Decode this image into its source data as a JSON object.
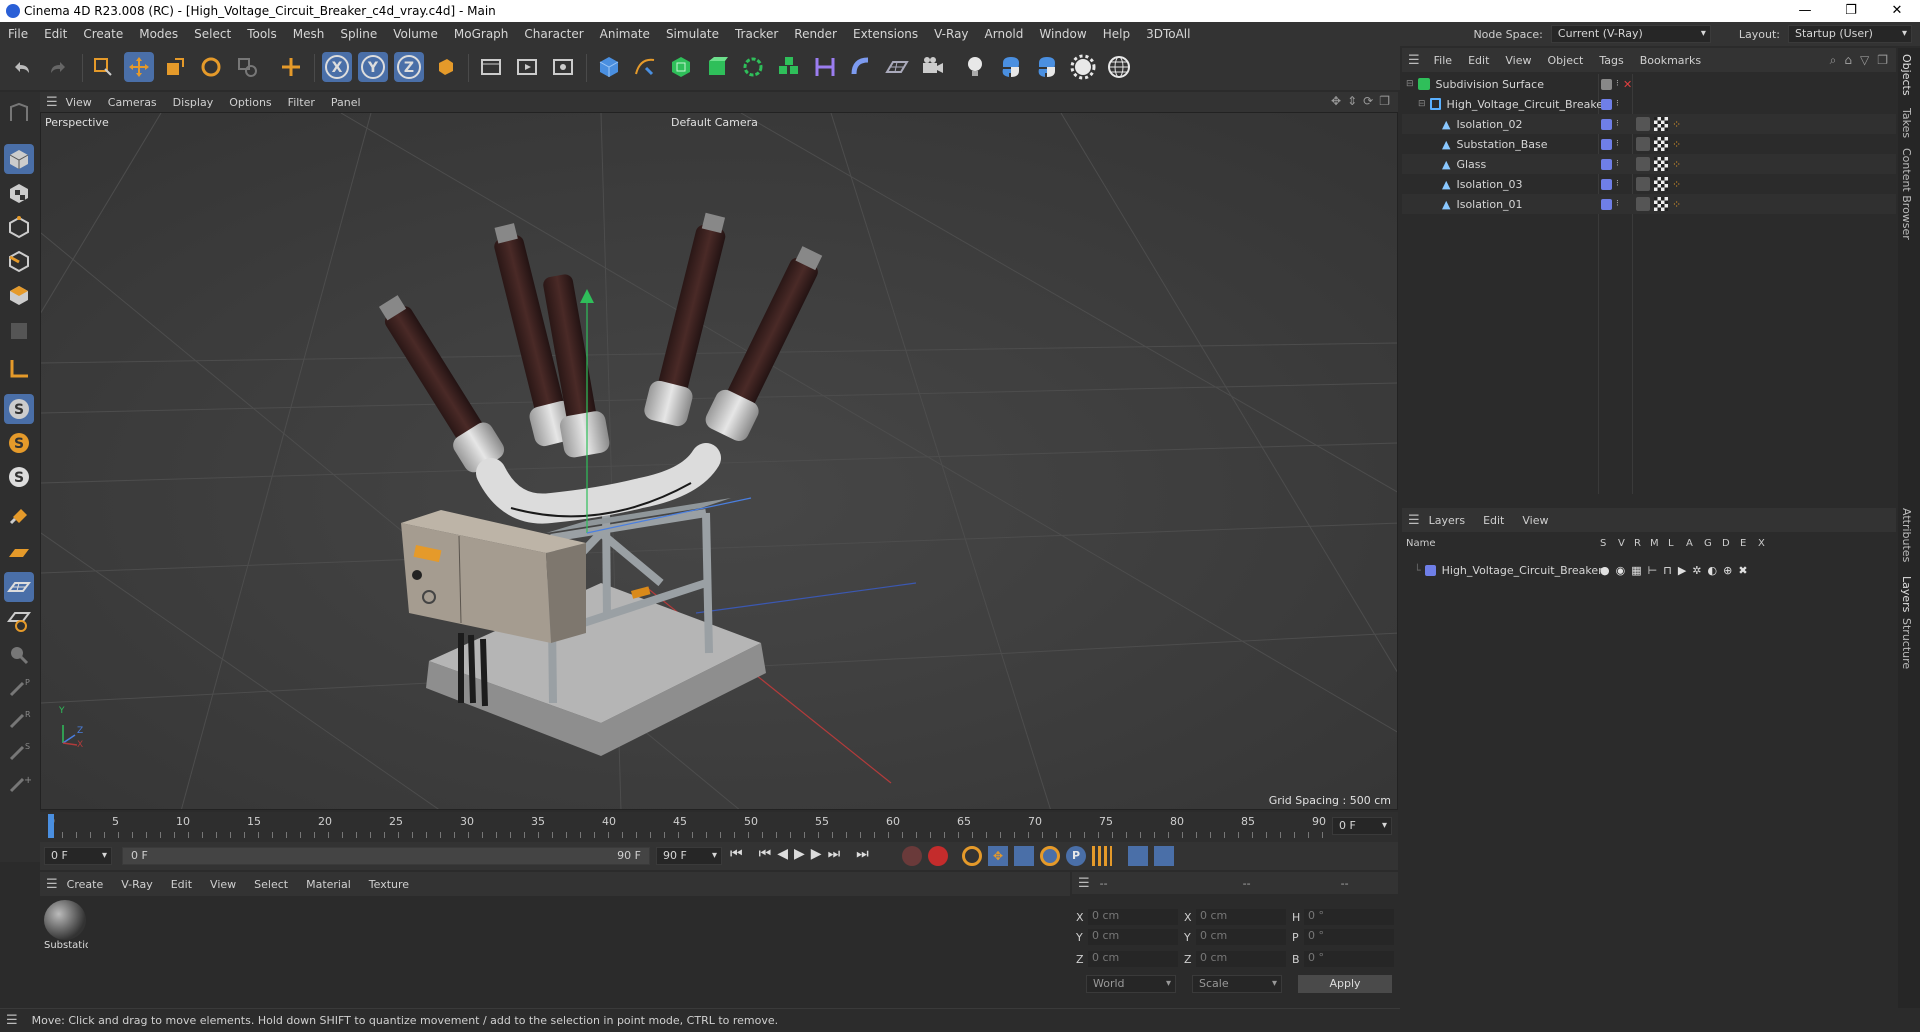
{
  "window": {
    "title": "Cinema 4D R23.008 (RC) - [High_Voltage_Circuit_Breaker_c4d_vray.c4d] - Main",
    "controls": [
      "—",
      "❐",
      "✕"
    ]
  },
  "menubar": {
    "items": [
      "File",
      "Edit",
      "Create",
      "Modes",
      "Select",
      "Tools",
      "Mesh",
      "Spline",
      "Volume",
      "MoGraph",
      "Character",
      "Animate",
      "Simulate",
      "Tracker",
      "Render",
      "Extensions",
      "V-Ray",
      "Arnold",
      "Window",
      "Help",
      "3DToAll"
    ],
    "node_space_label": "Node Space:",
    "node_space_value": "Current (V-Ray)",
    "layout_label": "Layout:",
    "layout_value": "Startup (User)"
  },
  "viewport": {
    "menu": [
      "View",
      "Cameras",
      "Display",
      "Options",
      "Filter",
      "Panel"
    ],
    "name": "Perspective",
    "camera": "Default Camera",
    "grid_spacing": "Grid Spacing : 500 cm",
    "axis_labels": {
      "y": "Y",
      "z": "Z",
      "x": "X"
    }
  },
  "timeline": {
    "ticks": [
      "0",
      "5",
      "10",
      "15",
      "20",
      "25",
      "30",
      "35",
      "40",
      "45",
      "50",
      "55",
      "60",
      "65",
      "70",
      "75",
      "80",
      "85",
      "90"
    ],
    "current_frame": "0 F",
    "start": "0 F",
    "range_start": "0 F",
    "range_end": "90 F",
    "end": "90 F"
  },
  "material_panel": {
    "menu": [
      "Create",
      "V-Ray",
      "Edit",
      "View",
      "Select",
      "Material",
      "Texture"
    ],
    "materials": [
      {
        "name": "Substatio"
      }
    ]
  },
  "coordinates": {
    "headers": [
      "--",
      "--",
      "--"
    ],
    "rows": [
      {
        "a": "X",
        "av": "0 cm",
        "b": "X",
        "bv": "0 cm",
        "c": "H",
        "cv": "0 °"
      },
      {
        "a": "Y",
        "av": "0 cm",
        "b": "Y",
        "bv": "0 cm",
        "c": "P",
        "cv": "0 °"
      },
      {
        "a": "Z",
        "av": "0 cm",
        "b": "Z",
        "bv": "0 cm",
        "c": "B",
        "cv": "0 °"
      }
    ],
    "space": "World",
    "mode": "Scale",
    "apply": "Apply"
  },
  "status": "Move: Click and drag to move elements. Hold down SHIFT to quantize movement / add to the selection in point mode, CTRL to remove.",
  "object_manager": {
    "menu": [
      "File",
      "Edit",
      "View",
      "Object",
      "Tags",
      "Bookmarks"
    ],
    "objects": [
      {
        "name": "Subdivision Surface",
        "level": 0
      },
      {
        "name": "High_Voltage_Circuit_Breaker",
        "level": 1
      },
      {
        "name": "Isolation_02",
        "level": 2
      },
      {
        "name": "Substation_Base",
        "level": 2
      },
      {
        "name": "Glass",
        "level": 2
      },
      {
        "name": "Isolation_03",
        "level": 2
      },
      {
        "name": "Isolation_01",
        "level": 2
      }
    ]
  },
  "layers": {
    "menu": [
      "Layers",
      "Edit",
      "View"
    ],
    "col_name": "Name",
    "cols": [
      "S",
      "V",
      "R",
      "M",
      "L",
      "A",
      "G",
      "D",
      "E",
      "X"
    ],
    "items": [
      {
        "name": "High_Voltage_Circuit_Breaker",
        "color": "#6f7fe8"
      }
    ]
  },
  "side_tabs": [
    "Objects",
    "Takes",
    "Content Browser",
    "Attributes",
    "Layers",
    "Structure"
  ],
  "colors": {
    "accent": "#4a8fe0",
    "layer": "#6f7fe8",
    "orange": "#e59a2a"
  }
}
